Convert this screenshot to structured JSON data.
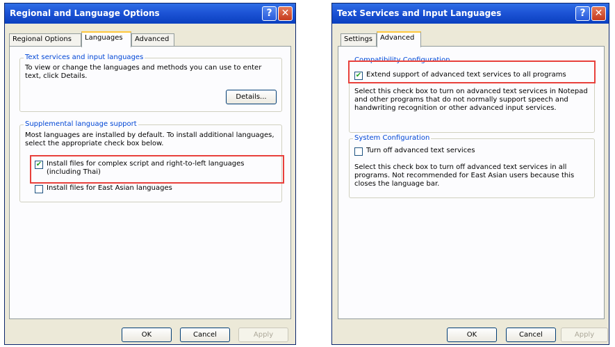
{
  "dialog1": {
    "title": "Regional and Language Options",
    "tabs": [
      "Regional Options",
      "Languages",
      "Advanced"
    ],
    "group1": {
      "legend": "Text services and input languages",
      "description": "To view or change the languages and methods you can use to enter text, click Details.",
      "details_button": "Details..."
    },
    "group2": {
      "legend": "Supplemental language support",
      "description": "Most languages are installed by default. To install additional languages, select the appropriate check box below.",
      "checkbox1": {
        "label": "Install files for complex script and right-to-left languages (including Thai)",
        "checked": true
      },
      "checkbox2": {
        "label": "Install files for East Asian languages",
        "checked": false
      }
    },
    "buttons": {
      "ok": "OK",
      "cancel": "Cancel",
      "apply": "Apply"
    }
  },
  "dialog2": {
    "title": "Text Services and Input Languages",
    "tabs": [
      "Settings",
      "Advanced"
    ],
    "group1": {
      "legend": "Compatibility Configuration",
      "checkbox": {
        "label": "Extend support of advanced text services to all programs",
        "checked": true
      },
      "description": "Select this check box to turn on advanced text services in Notepad and other programs that do not normally support speech and handwriting recognition or other advanced input services."
    },
    "group2": {
      "legend": "System Configuration",
      "checkbox": {
        "label": "Turn off advanced text services",
        "checked": false
      },
      "description": "Select this check box to turn off advanced text services in all programs. Not recommended for East Asian users because this closes the language bar."
    },
    "buttons": {
      "ok": "OK",
      "cancel": "Cancel",
      "apply": "Apply"
    }
  },
  "titlebar_buttons": {
    "help": "?",
    "close": "✕"
  },
  "check_mark": "✔",
  "colors": {
    "titlebar": "#1d54d6",
    "legend": "#0046d5",
    "highlight": "#e8403b",
    "dialog_bg": "#ece9d8"
  }
}
